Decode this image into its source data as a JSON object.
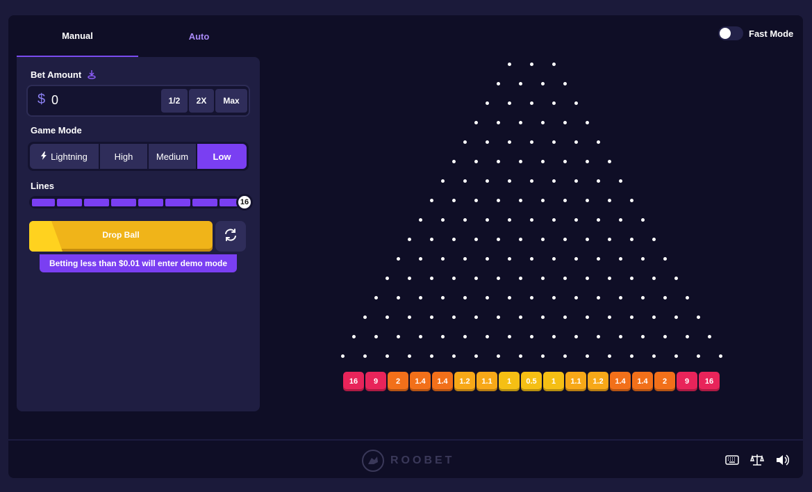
{
  "tabs": [
    {
      "label": "Manual"
    },
    {
      "label": "Auto"
    }
  ],
  "bet": {
    "label": "Bet Amount",
    "currency_symbol": "$",
    "value": "0",
    "half_label": "1/2",
    "double_label": "2X",
    "max_label": "Max"
  },
  "game_mode": {
    "label": "Game Mode",
    "options": [
      "Lightning",
      "High",
      "Medium",
      "Low"
    ],
    "selected": "Low"
  },
  "lines": {
    "label": "Lines",
    "value": "16"
  },
  "drop_ball": {
    "label": "Drop Ball"
  },
  "demo_notice": "Betting less than $0.01 will enter demo mode",
  "fast_mode": {
    "label": "Fast Mode",
    "enabled": false
  },
  "multipliers": [
    "16",
    "9",
    "2",
    "1.4",
    "1.4",
    "1.2",
    "1.1",
    "1",
    "0.5",
    "1",
    "1.1",
    "1.2",
    "1.4",
    "1.4",
    "2",
    "9",
    "16"
  ],
  "logo": {
    "text": "ROOBET"
  },
  "colors": {
    "accent": "#7a3ff2",
    "drop": "#f0b419",
    "slot_red": "#e8245a",
    "slot_orange": "#f2701a",
    "slot_amber": "#f7a818",
    "slot_yellow": "#f5bf14"
  },
  "icons": {
    "keyboard": "keyboard-icon",
    "fairness": "scale-icon",
    "sound": "speaker-icon"
  }
}
